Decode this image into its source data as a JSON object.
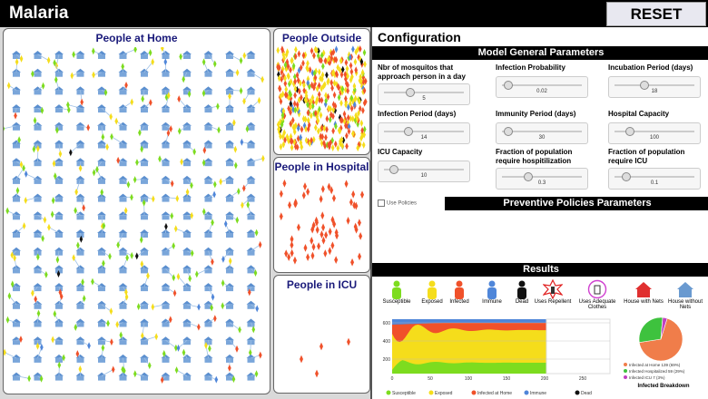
{
  "app": {
    "title": "Malaria",
    "reset_label": "RESET"
  },
  "panels": {
    "home": "People at Home",
    "outside": "People Outside",
    "hospital": "People in Hospital",
    "icu": "People in ICU"
  },
  "config": {
    "title": "Configuration",
    "general_header": "Model General Parameters",
    "params": [
      {
        "label": "Nbr of mosquitos that approach person in a day",
        "value": "5",
        "fraction": 0.3
      },
      {
        "label": "Infection Probability",
        "value": "0.02",
        "fraction": 0.02
      },
      {
        "label": "Incubation Period (days)",
        "value": "18",
        "fraction": 0.35
      },
      {
        "label": "Infection Period (days)",
        "value": "14",
        "fraction": 0.28
      },
      {
        "label": "Immunity Period (days)",
        "value": "30",
        "fraction": 0.03
      },
      {
        "label": "Hospital Capacity",
        "value": "100",
        "fraction": 0.15
      },
      {
        "label": "ICU Capacity",
        "value": "10",
        "fraction": 0.08
      },
      {
        "label": "Fraction of population require hospitilization",
        "value": "0.3",
        "fraction": 0.3
      },
      {
        "label": "Fraction of population require ICU",
        "value": "0.1",
        "fraction": 0.1
      }
    ],
    "use_policies_label": "Use Policies",
    "policies_header": "Preventive Policies Parameters"
  },
  "results": {
    "header": "Results",
    "legend": [
      {
        "label": "Susceptible",
        "color": "#7ddc1f",
        "icon": "person-icon"
      },
      {
        "label": "Exposed",
        "color": "#f5dd1b",
        "icon": "person-icon"
      },
      {
        "label": "Infected",
        "color": "#f0512a",
        "icon": "person-icon"
      },
      {
        "label": "Immune",
        "color": "#4f86d9",
        "icon": "person-icon"
      },
      {
        "label": "Dead",
        "color": "#111111",
        "icon": "person-icon"
      },
      {
        "label": "Uses Repellent",
        "color": "#e02020",
        "icon": "repellent-icon"
      },
      {
        "label": "Uses Adequate Clothes",
        "color": "#d040d0",
        "icon": "clothes-icon"
      },
      {
        "label": "House with Nets",
        "color": "#e03030",
        "icon": "house-icon"
      },
      {
        "label": "House without Nets",
        "color": "#6a9ad0",
        "icon": "house-icon"
      }
    ],
    "chart_data": {
      "type": "area",
      "yticks": [
        "600",
        "400",
        "200"
      ],
      "xticks": [
        "0",
        "50",
        "100",
        "150",
        "200",
        "250"
      ],
      "series_legend": [
        "Susceptible",
        "Exposed",
        "Infected at Home",
        "Immune",
        "Dead"
      ],
      "series_colors": [
        "#7ddc1f",
        "#f5dd1b",
        "#f0512a",
        "#4f86d9",
        "#111111"
      ]
    },
    "pie": {
      "type": "pie",
      "slices": [
        {
          "label": "Infected at Home",
          "value": 139,
          "pct": "(69%)",
          "color": "#f07d4a"
        },
        {
          "label": "Infected Hospitalized",
          "value": 59,
          "pct": "(29%)",
          "color": "#3ec23e"
        },
        {
          "label": "Infected ICU",
          "value": 7,
          "pct": "(3%)",
          "color": "#c040c0"
        }
      ],
      "title": "Infected Breakdown"
    }
  }
}
